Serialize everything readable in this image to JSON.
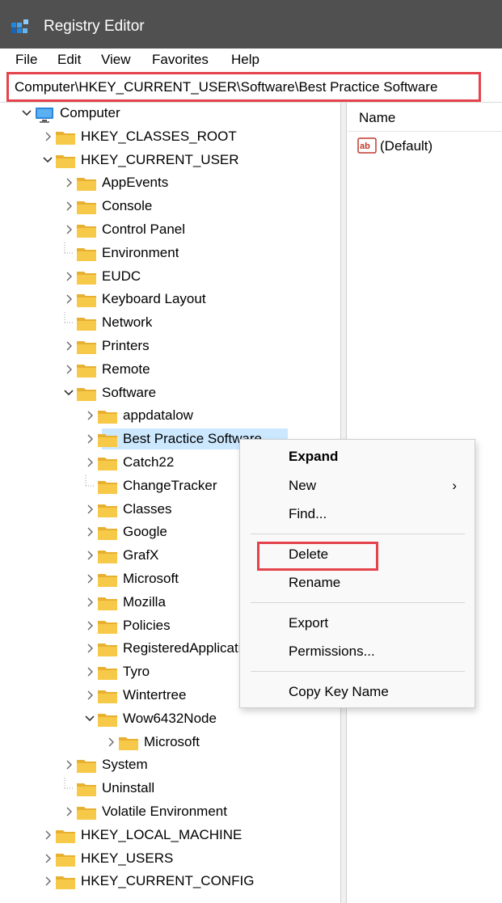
{
  "window": {
    "title": "Registry Editor"
  },
  "menu": [
    "File",
    "Edit",
    "View",
    "Favorites",
    "Help"
  ],
  "address": "Computer\\HKEY_CURRENT_USER\\Software\\Best Practice Software",
  "tree": [
    {
      "label": "Computer",
      "expanded": true
    },
    {
      "label": "HKEY_CLASSES_ROOT"
    },
    {
      "label": "HKEY_CURRENT_USER",
      "expanded": true
    },
    {
      "label": "AppEvents"
    },
    {
      "label": "Console"
    },
    {
      "label": "Control Panel"
    },
    {
      "label": "Environment"
    },
    {
      "label": "EUDC"
    },
    {
      "label": "Keyboard Layout"
    },
    {
      "label": "Network"
    },
    {
      "label": "Printers"
    },
    {
      "label": "Remote"
    },
    {
      "label": "Software",
      "expanded": true
    },
    {
      "label": "appdatalow"
    },
    {
      "label": "Best Practice Software",
      "selected": true
    },
    {
      "label": "Catch22"
    },
    {
      "label": "ChangeTracker"
    },
    {
      "label": "Classes"
    },
    {
      "label": "Google"
    },
    {
      "label": "GrafX"
    },
    {
      "label": "Microsoft"
    },
    {
      "label": "Mozilla"
    },
    {
      "label": "Policies"
    },
    {
      "label": "RegisteredApplications"
    },
    {
      "label": "Tyro"
    },
    {
      "label": "Wintertree"
    },
    {
      "label": "Wow6432Node",
      "expanded": true
    },
    {
      "label": "Microsoft"
    },
    {
      "label": "System"
    },
    {
      "label": "Uninstall"
    },
    {
      "label": "Volatile Environment"
    },
    {
      "label": "HKEY_LOCAL_MACHINE"
    },
    {
      "label": "HKEY_USERS"
    },
    {
      "label": "HKEY_CURRENT_CONFIG"
    }
  ],
  "values_pane": {
    "column_header": "Name",
    "values": [
      {
        "name": "(Default)",
        "icon": "string-value-icon"
      }
    ]
  },
  "context_menu": {
    "expand": "Expand",
    "new": "New",
    "find": "Find...",
    "delete": "Delete",
    "rename": "Rename",
    "export": "Export",
    "permissions": "Permissions...",
    "copy_key_name": "Copy Key Name"
  },
  "colors": {
    "titlebar": "#505050",
    "selection": "#cce8ff",
    "highlight_box": "#e5434b",
    "folder": "#f4c542"
  }
}
